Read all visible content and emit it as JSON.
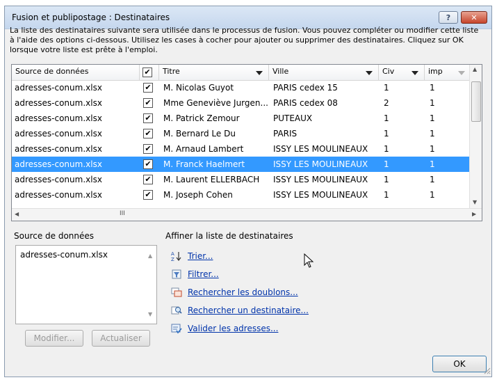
{
  "window": {
    "title": "Fusion et publipostage : Destinataires",
    "help_label": "?",
    "close_label": "✕"
  },
  "intro_text": "La liste des destinataires suivante sera utilisée dans le processus de fusion. Vous pouvez compléter ou modifier cette liste à l'aide des options ci-dessous. Utilisez les cases à cocher pour ajouter ou supprimer des destinataires. Cliquez sur OK lorsque votre liste est prête à l'emploi.",
  "grid": {
    "headers": {
      "source": "Source de données",
      "titre": "Titre",
      "ville": "Ville",
      "civ": "Civ",
      "imp": "imp"
    },
    "rows": [
      {
        "source": "adresses-conum.xlsx",
        "checked": true,
        "titre": "M. Nicolas Guyot",
        "ville": "PARIS cedex 15",
        "civ": "1",
        "imp": "1"
      },
      {
        "source": "adresses-conum.xlsx",
        "checked": true,
        "titre": "Mme Geneviève Jurgen...",
        "ville": "PARIS cedex 08",
        "civ": "2",
        "imp": "1"
      },
      {
        "source": "adresses-conum.xlsx",
        "checked": true,
        "titre": "M. Patrick Zemour",
        "ville": "PUTEAUX",
        "civ": "1",
        "imp": "1"
      },
      {
        "source": "adresses-conum.xlsx",
        "checked": true,
        "titre": "M. Bernard Le Du",
        "ville": "PARIS",
        "civ": "1",
        "imp": "1"
      },
      {
        "source": "adresses-conum.xlsx",
        "checked": true,
        "titre": "M. Arnaud Lambert",
        "ville": "ISSY LES MOULINEAUX",
        "civ": "1",
        "imp": "1"
      },
      {
        "source": "adresses-conum.xlsx",
        "checked": true,
        "titre": "M. Franck Haelmert",
        "ville": "ISSY LES MOULINEAUX",
        "civ": "1",
        "imp": "1",
        "selected": true
      },
      {
        "source": "adresses-conum.xlsx",
        "checked": true,
        "titre": "M. Laurent ELLERBACH",
        "ville": "ISSY LES MOULINEAUX",
        "civ": "1",
        "imp": "1"
      },
      {
        "source": "adresses-conum.xlsx",
        "checked": true,
        "titre": "M. Joseph Cohen",
        "ville": "ISSY LES MOULINEAUX",
        "civ": "1",
        "imp": "1"
      }
    ],
    "hscroll_grip": "III"
  },
  "data_sources": {
    "label": "Source de données",
    "items": [
      "adresses-conum.xlsx"
    ],
    "modify_label": "Modifier...",
    "refresh_label": "Actualiser"
  },
  "refine": {
    "label": "Affiner la liste de destinataires",
    "links": [
      {
        "label": "Trier...",
        "icon": "sort-icon"
      },
      {
        "label": "Filtrer...",
        "icon": "filter-icon"
      },
      {
        "label": "Rechercher les doublons...",
        "icon": "duplicates-icon"
      },
      {
        "label": "Rechercher un destinataire...",
        "icon": "find-recipient-icon"
      },
      {
        "label": "Valider les adresses...",
        "icon": "validate-icon"
      }
    ]
  },
  "ok_label": "OK",
  "colors": {
    "selection": "#3399ff",
    "link": "#0033aa"
  }
}
